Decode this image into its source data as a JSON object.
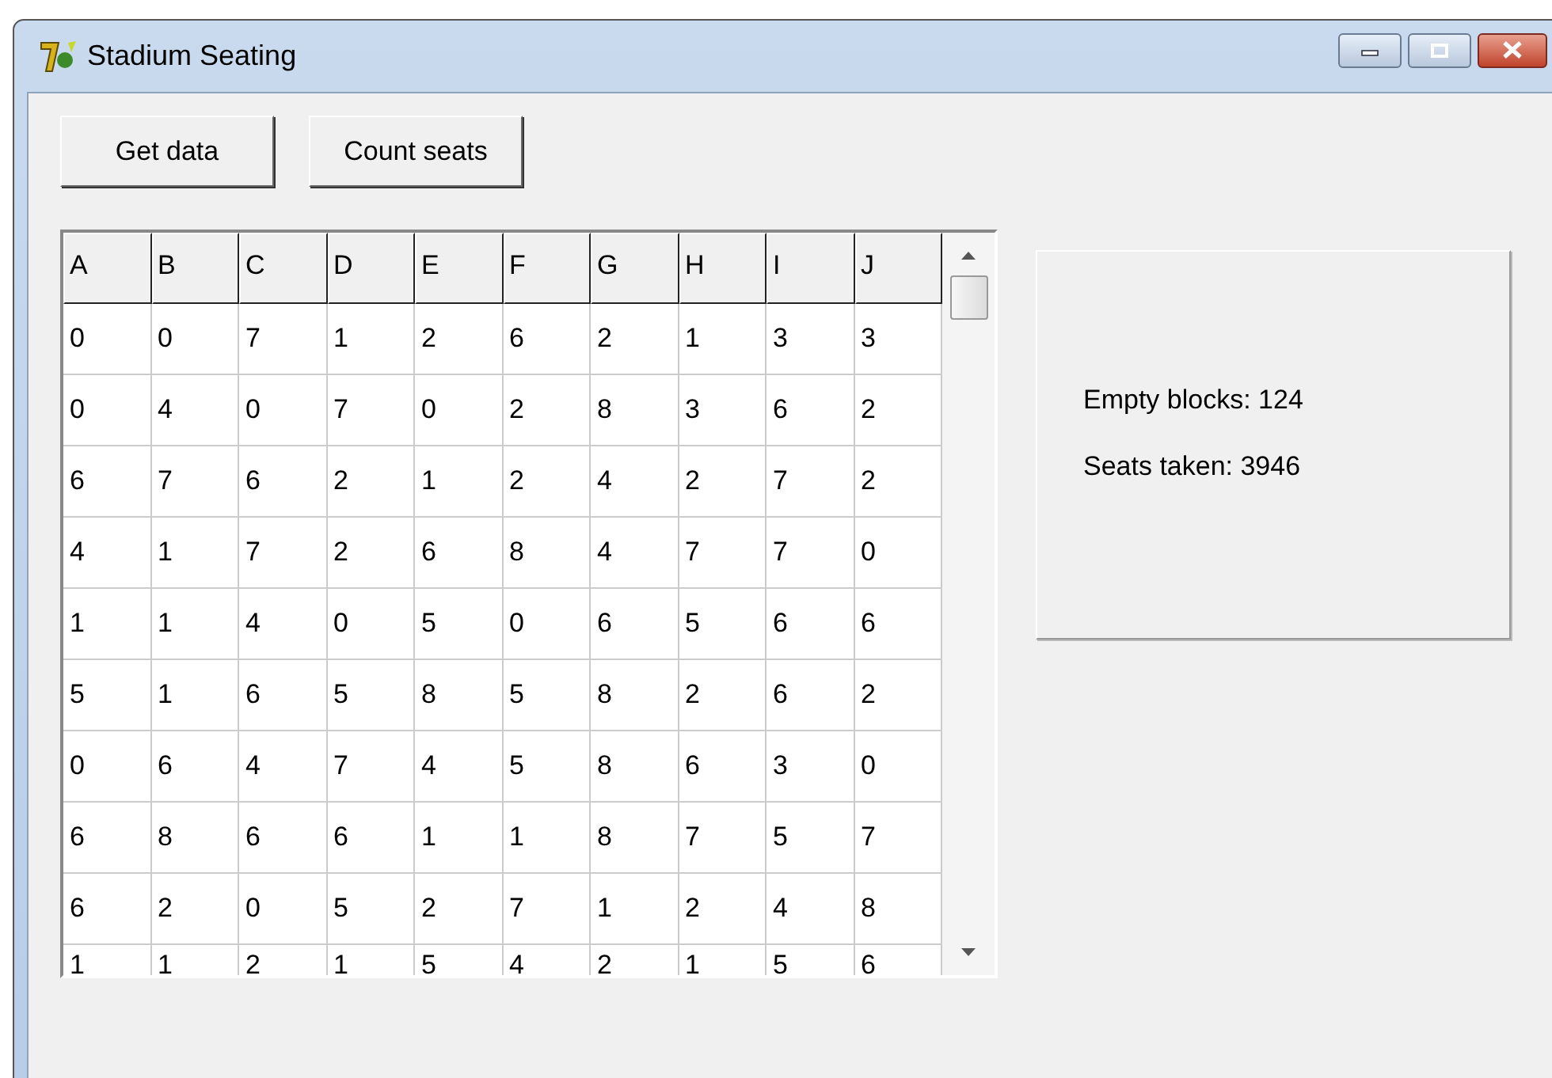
{
  "window": {
    "title": "Stadium Seating"
  },
  "buttons": [
    "Get data",
    "Count seats"
  ],
  "table": {
    "columns": [
      "A",
      "B",
      "C",
      "D",
      "E",
      "F",
      "G",
      "H",
      "I",
      "J"
    ],
    "rows": [
      [
        "0",
        "0",
        "7",
        "1",
        "2",
        "6",
        "2",
        "1",
        "3",
        "3"
      ],
      [
        "0",
        "4",
        "0",
        "7",
        "0",
        "2",
        "8",
        "3",
        "6",
        "2"
      ],
      [
        "6",
        "7",
        "6",
        "2",
        "1",
        "2",
        "4",
        "2",
        "7",
        "2"
      ],
      [
        "4",
        "1",
        "7",
        "2",
        "6",
        "8",
        "4",
        "7",
        "7",
        "0"
      ],
      [
        "1",
        "1",
        "4",
        "0",
        "5",
        "0",
        "6",
        "5",
        "6",
        "6"
      ],
      [
        "5",
        "1",
        "6",
        "5",
        "8",
        "5",
        "8",
        "2",
        "6",
        "2"
      ],
      [
        "0",
        "6",
        "4",
        "7",
        "4",
        "5",
        "8",
        "6",
        "3",
        "0"
      ],
      [
        "6",
        "8",
        "6",
        "6",
        "1",
        "1",
        "8",
        "7",
        "5",
        "7"
      ],
      [
        "6",
        "2",
        "0",
        "5",
        "2",
        "7",
        "1",
        "2",
        "4",
        "8"
      ],
      [
        "1",
        "1",
        "2",
        "1",
        "5",
        "4",
        "2",
        "1",
        "5",
        "6"
      ]
    ]
  },
  "results": [
    "Empty blocks: 124",
    "Seats taken: 3946"
  ]
}
